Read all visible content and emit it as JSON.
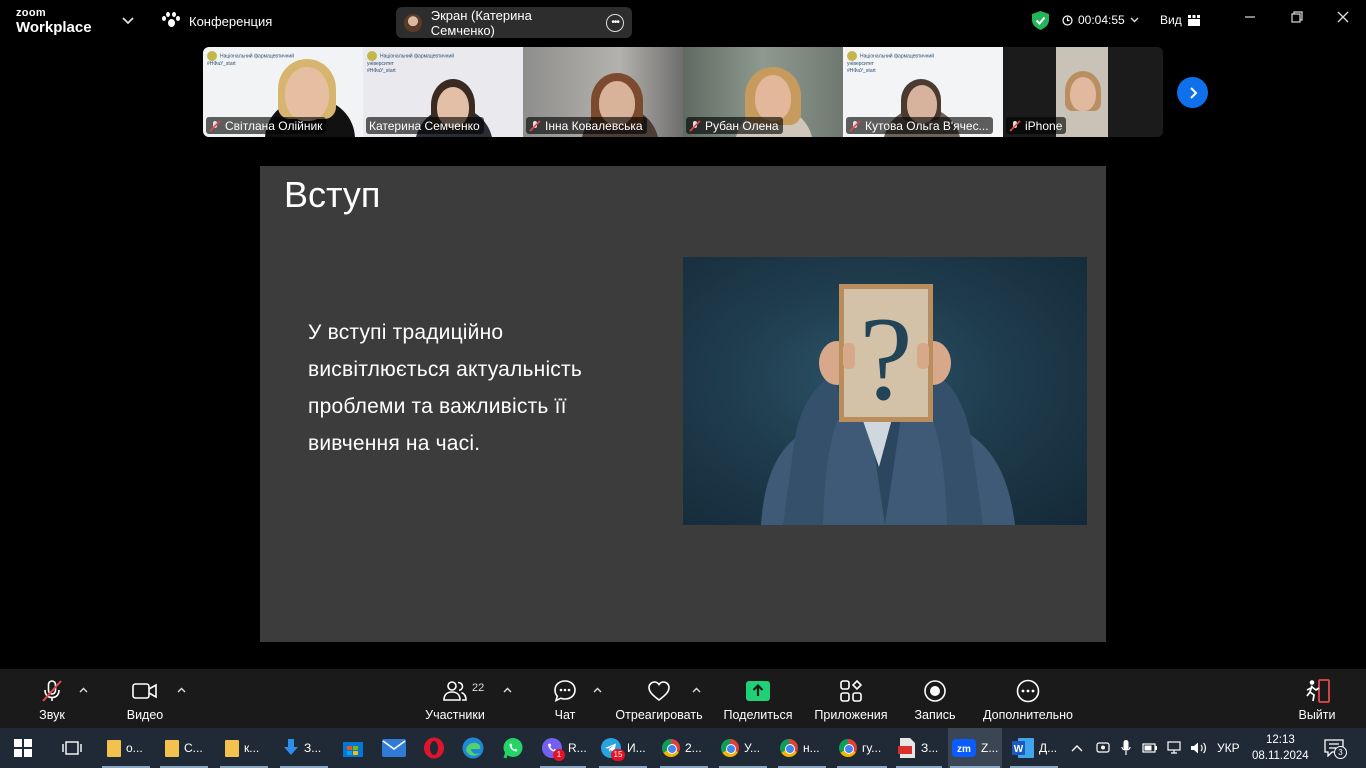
{
  "app": {
    "logo_line1": "zoom",
    "logo_line2": "Workplace",
    "meeting_label": "Конференция",
    "share_label": "Экран (Катерина Семченко)",
    "timer": "00:04:55",
    "view_label": "Вид",
    "colors": {
      "accent_blue": "#0e71eb",
      "active_green": "#3ddc84",
      "share_green": "#1fd074",
      "mute_red": "#e5484d"
    }
  },
  "participants": [
    {
      "name": "Світлана Олійник",
      "muted": true
    },
    {
      "name": "Катерина Семченко",
      "muted": false,
      "active": true
    },
    {
      "name": "Інна Ковалевська",
      "muted": true
    },
    {
      "name": "Рубан Олена",
      "muted": true
    },
    {
      "name": "Кутова Ольга В'ячес...",
      "muted": true
    },
    {
      "name": "iPhone",
      "muted": true
    }
  ],
  "tile_header": {
    "line1": "Національний фармацевтичний",
    "line2": "університет",
    "line3": "#НФаУ_start"
  },
  "slide": {
    "title": "Вступ",
    "body": "У вступі традиційно висвітлюється актуальність проблеми та важливість її вивчення на часі."
  },
  "toolbar": {
    "audio": "Звук",
    "video": "Видео",
    "participants": "Участники",
    "participants_count": "22",
    "chat": "Чат",
    "react": "Отреагировать",
    "share": "Поделиться",
    "apps": "Приложения",
    "record": "Запись",
    "more": "Дополнительно",
    "leave": "Выйти"
  },
  "taskbar": {
    "items": [
      {
        "label": "о...",
        "icon": "folder-icon"
      },
      {
        "label": "С...",
        "icon": "folder-icon"
      },
      {
        "label": "к...",
        "icon": "folder-icon"
      },
      {
        "label": "З...",
        "icon": "download-icon"
      },
      {
        "label": "",
        "icon": "store-icon"
      },
      {
        "label": "",
        "icon": "mail-icon"
      },
      {
        "label": "",
        "icon": "opera-icon"
      },
      {
        "label": "",
        "icon": "edge-icon"
      },
      {
        "label": "",
        "icon": "whatsapp-icon"
      },
      {
        "label": "R...",
        "icon": "viber-icon",
        "badge": "1"
      },
      {
        "label": "И...",
        "icon": "telegram-icon",
        "badge": "15"
      },
      {
        "label": "2...",
        "icon": "chrome-icon"
      },
      {
        "label": "У...",
        "icon": "chrome-icon"
      },
      {
        "label": "н...",
        "icon": "chrome-icon"
      },
      {
        "label": "гу...",
        "icon": "chrome-icon"
      },
      {
        "label": "З...",
        "icon": "pdf-icon"
      },
      {
        "label": "Z...",
        "icon": "zoom-icon"
      },
      {
        "label": "Д...",
        "icon": "word-icon"
      }
    ],
    "language": "УКР",
    "time": "12:13",
    "date": "08.11.2024",
    "notifications": "3"
  }
}
